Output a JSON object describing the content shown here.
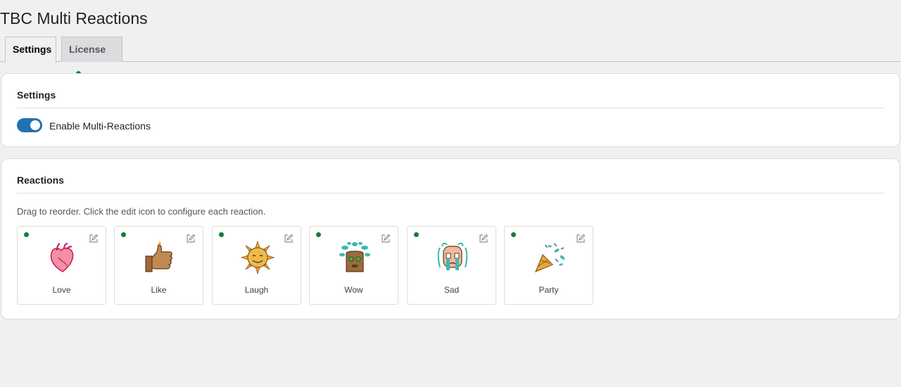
{
  "page": {
    "title": "TBC Multi Reactions"
  },
  "tabs": [
    {
      "label": "Settings",
      "active": true
    },
    {
      "label": "License",
      "active": false,
      "status_color": "#1a7e32"
    }
  ],
  "settings_card": {
    "title": "Settings",
    "toggle": {
      "label": "Enable Multi-Reactions",
      "enabled": true
    }
  },
  "reactions_card": {
    "title": "Reactions",
    "hint": "Drag to reorder. Click the edit icon to configure each reaction.",
    "items": [
      {
        "label": "Love",
        "icon": "anatomical-heart-icon",
        "active": true
      },
      {
        "label": "Like",
        "icon": "thumbs-up-icon",
        "active": true
      },
      {
        "label": "Laugh",
        "icon": "sun-face-icon",
        "active": true
      },
      {
        "label": "Wow",
        "icon": "tree-face-icon",
        "active": true
      },
      {
        "label": "Sad",
        "icon": "crying-face-icon",
        "active": true
      },
      {
        "label": "Party",
        "icon": "party-popper-icon",
        "active": true
      }
    ]
  },
  "colors": {
    "accent": "#2271b1",
    "status_active": "#1a7e32"
  }
}
